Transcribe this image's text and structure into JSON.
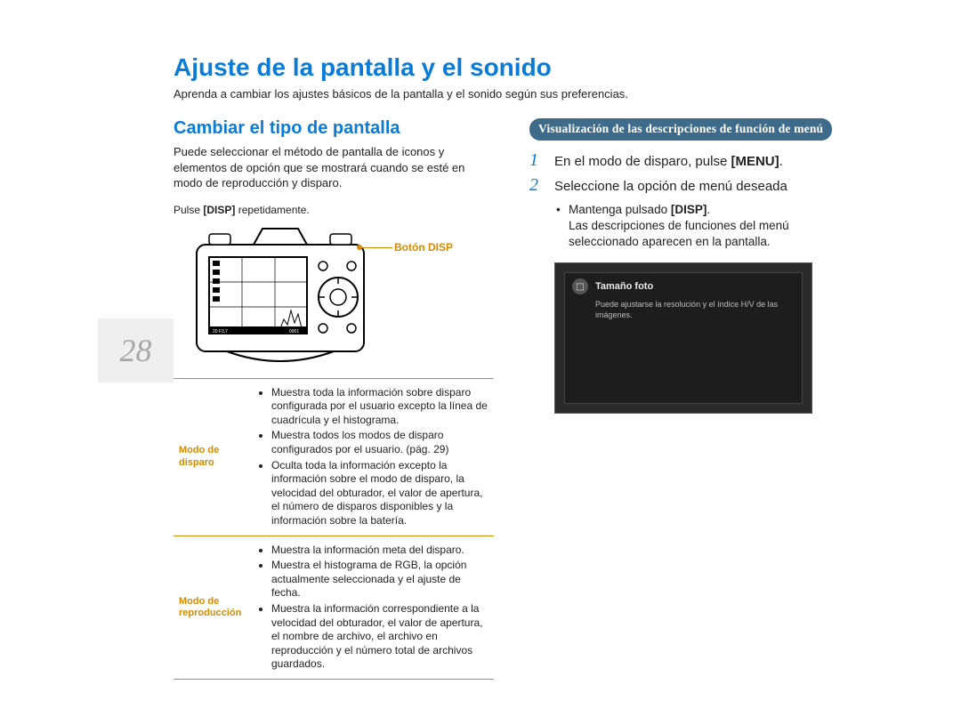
{
  "page_number": "28",
  "main_title": "Ajuste de la pantalla y el sonido",
  "intro": "Aprenda a cambiar los ajustes básicos de la pantalla y el sonido según sus preferencias.",
  "left": {
    "section_title": "Cambiar el tipo de pantalla",
    "para": "Puede seleccionar el método de pantalla de iconos y elementos de opción que se mostrará cuando se esté en modo de reproducción y disparo.",
    "pulse_prefix": "Pulse ",
    "pulse_key": "[DISP]",
    "pulse_suffix": " repetidamente.",
    "disp_button_label": "Botón DISP",
    "table": {
      "row1_head": "Modo de disparo",
      "row1_items": [
        "Muestra toda la información sobre disparo configurada por el usuario excepto la línea de cuadrícula y el histograma.",
        "Muestra todos los modos de disparo configurados por el usuario. (pág. 29)",
        "Oculta toda la información excepto la información sobre el modo de disparo, la velocidad del obturador, el valor de apertura, el número de disparos disponibles y la información sobre la batería."
      ],
      "row2_head": "Modo de reproducción",
      "row2_items": [
        "Muestra la información meta del disparo.",
        "Muestra el histograma de RGB, la opción actualmente seleccionada y el ajuste de fecha.",
        "Muestra la información correspondiente a la velocidad del obturador, el valor de apertura, el nombre de archivo, el archivo en reproducción y el número total de archivos guardados."
      ]
    }
  },
  "right": {
    "pill": "Visualización de las descripciones de función de menú",
    "step1_prefix": "En el modo de disparo, pulse ",
    "step1_key": "[MENU]",
    "step1_suffix": ".",
    "step2": "Seleccione la opción de menú deseada",
    "sub_prefix": "Mantenga pulsado ",
    "sub_key": "[DISP]",
    "sub_suffix": ".",
    "sub_line2": "Las descripciones de funciones del menú seleccionado aparecen en la pantalla.",
    "preview": {
      "title": "Tamaño foto",
      "icon_glyph": "⬚",
      "desc": "Puede ajustarse la resolución y el índice H/V de las imágenes."
    }
  }
}
